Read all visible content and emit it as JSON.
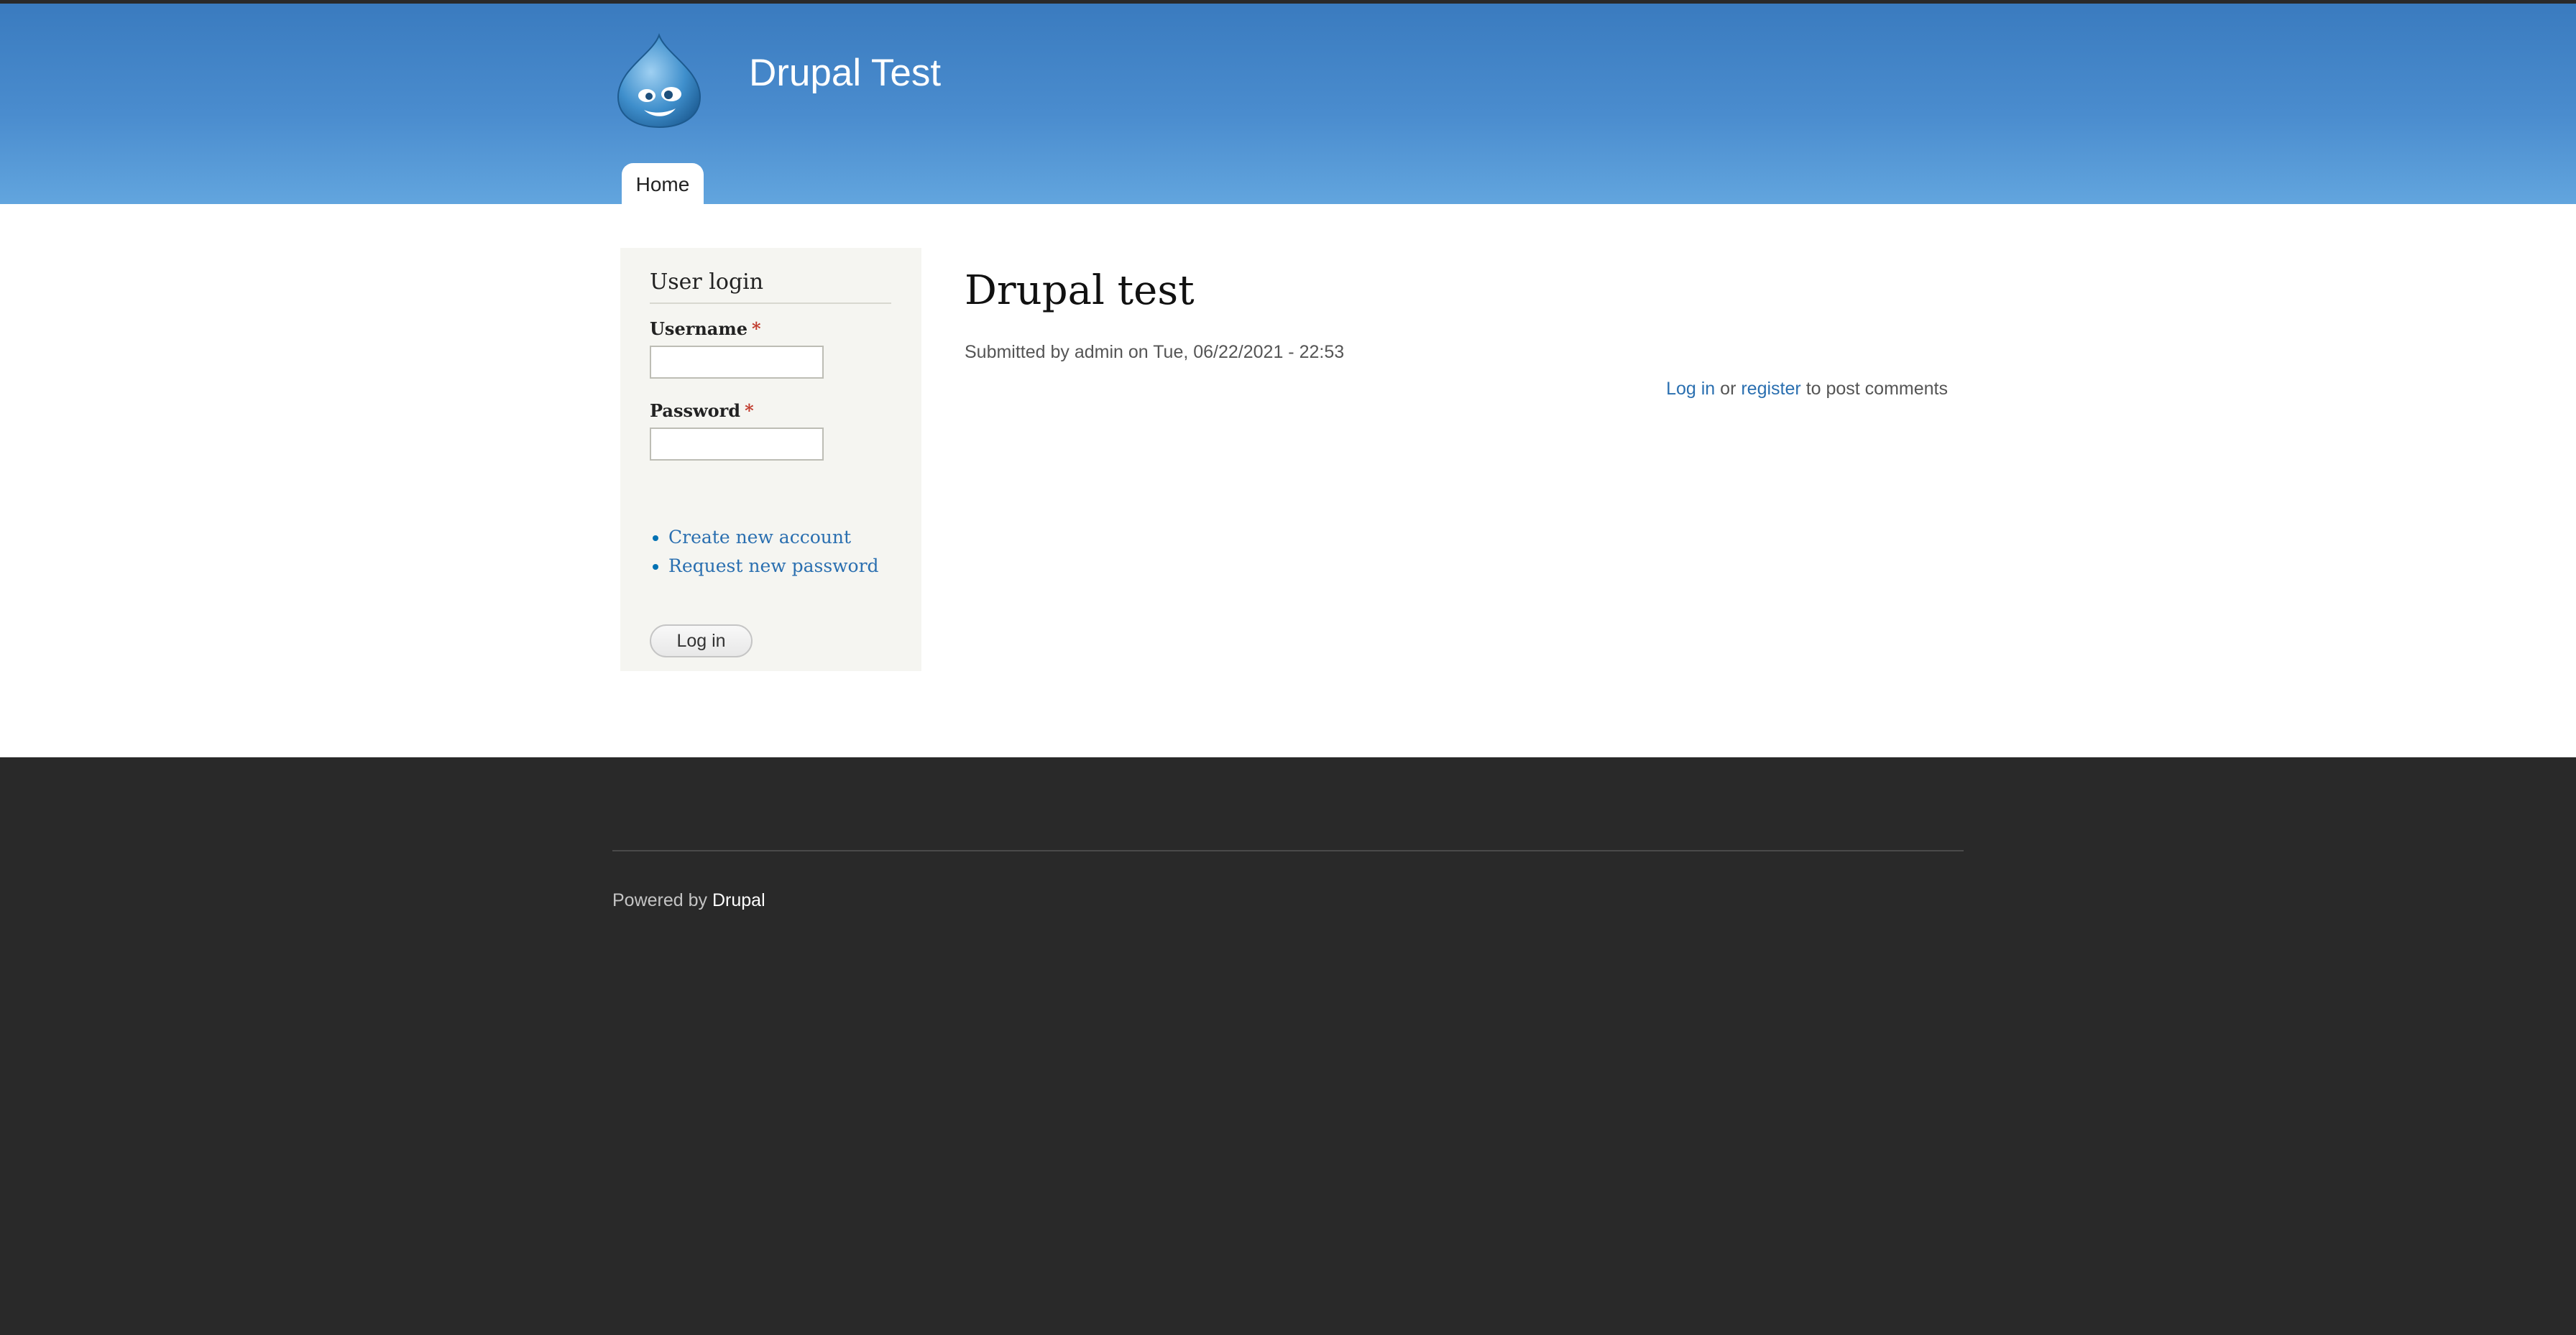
{
  "header": {
    "site_name": "Drupal Test",
    "nav": [
      {
        "label": "Home"
      }
    ]
  },
  "sidebar": {
    "block_title": "User login",
    "username_label": "Username",
    "password_label": "Password",
    "required_marker": "*",
    "username_value": "",
    "password_value": "",
    "links": [
      {
        "label": "Create new account"
      },
      {
        "label": "Request new password"
      }
    ],
    "submit_label": "Log in"
  },
  "content": {
    "title": "Drupal test",
    "submitted": "Submitted by admin on Tue, 06/22/2021 - 22:53",
    "comment_login_link": "Log in",
    "comment_or": "or",
    "comment_register_link": "register",
    "comment_suffix": "to post comments"
  },
  "footer": {
    "powered_prefix": "Powered by",
    "powered_link": "Drupal"
  },
  "colors": {
    "header_top": "#3a7bbf",
    "header_bottom": "#62a5de",
    "link": "#2a6fb0",
    "footer_bg": "#292929",
    "sidebar_bg": "#f5f5f1"
  },
  "icons": {
    "logo": "drupal-drop-logo-icon"
  }
}
